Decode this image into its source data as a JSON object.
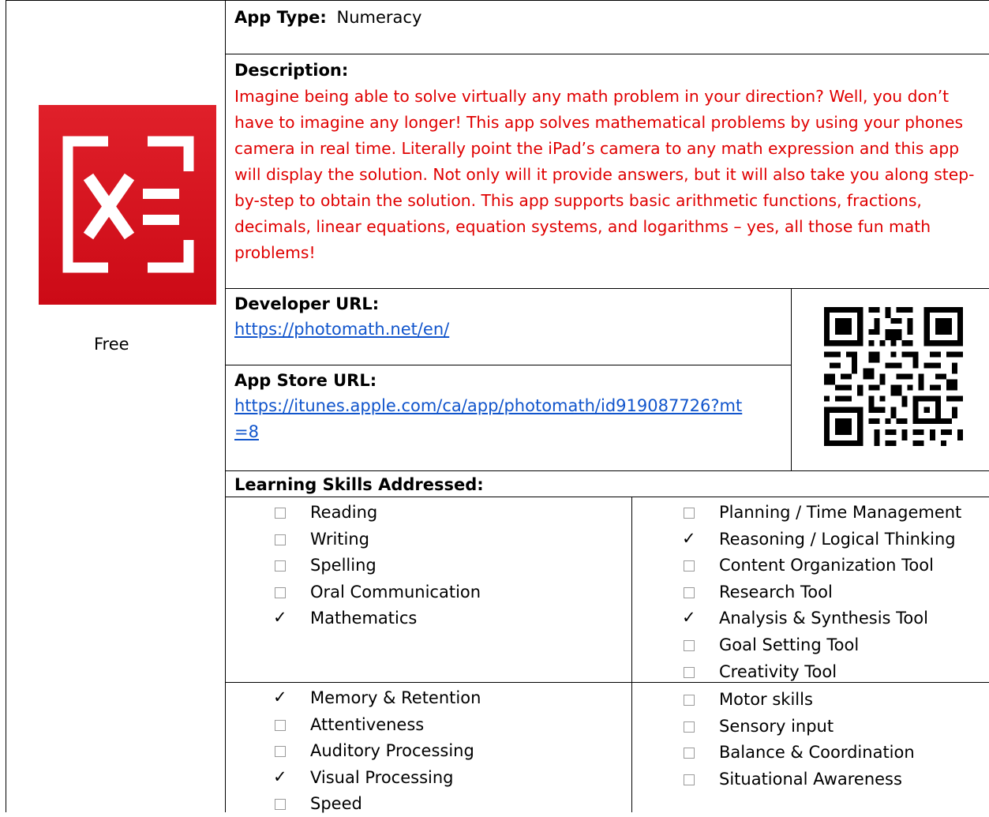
{
  "app_type": {
    "label": "App Type:",
    "value": "Numeracy"
  },
  "price": "Free",
  "description": {
    "label": "Description:",
    "text": "Imagine being able to solve virtually any math problem in your direction? Well, you don’t have to imagine any longer! This app solves mathematical problems by using your phones camera in real time. Literally point the iPad’s camera to any math expression and this app will display the solution. Not only will it provide answers, but it will also take you along step-by-step to obtain the solution. This app supports basic arithmetic functions, fractions, decimals, linear equations, equation systems, and logarithms – yes, all those fun math problems!",
    "color": "#e00000"
  },
  "logo": {
    "icon": "photomath-x-equals-icon",
    "color": "#d4141f"
  },
  "developer": {
    "label": "Developer URL:",
    "url": "https://photomath.net/en/"
  },
  "app_store": {
    "label": "App Store URL:",
    "url_line1": "https://itunes.apple.com/ca/app/photomath/id919087726?mt",
    "url_line2": "=8"
  },
  "qr_code": {
    "icon": "qr-code-icon"
  },
  "skills": {
    "label": "Learning Skills Addressed:",
    "top_left": [
      {
        "label": "Reading",
        "checked": false
      },
      {
        "label": "Writing",
        "checked": false
      },
      {
        "label": "Spelling",
        "checked": false
      },
      {
        "label": "Oral Communication",
        "checked": false
      },
      {
        "label": "Mathematics",
        "checked": true
      }
    ],
    "top_right": [
      {
        "label": "Planning / Time Management",
        "checked": false
      },
      {
        "label": "Reasoning / Logical Thinking",
        "checked": true
      },
      {
        "label": "Content Organization Tool",
        "checked": false
      },
      {
        "label": "Research Tool",
        "checked": false
      },
      {
        "label": "Analysis & Synthesis Tool",
        "checked": true
      },
      {
        "label": "Goal Setting Tool",
        "checked": false
      },
      {
        "label": "Creativity Tool",
        "checked": false
      }
    ],
    "bottom_left": [
      {
        "label": "Memory & Retention",
        "checked": true
      },
      {
        "label": "Attentiveness",
        "checked": false
      },
      {
        "label": "Auditory Processing",
        "checked": false
      },
      {
        "label": "Visual Processing",
        "checked": true
      },
      {
        "label": "Speed",
        "checked": false
      }
    ],
    "bottom_right": [
      {
        "label": "Motor skills",
        "checked": false
      },
      {
        "label": "Sensory input",
        "checked": false
      },
      {
        "label": "Balance & Coordination",
        "checked": false
      },
      {
        "label": "Situational Awareness",
        "checked": false
      }
    ]
  }
}
